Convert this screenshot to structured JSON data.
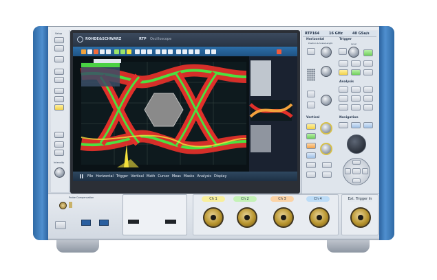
{
  "brand": {
    "logo_text": "ROHDE&SCHWARZ",
    "product": "RTP",
    "product_sub": "Oscilloscope"
  },
  "model": {
    "name": "RTP164",
    "bandwidth": "16 GHz",
    "sample_rate": "40 GSa/s"
  },
  "left_column": {
    "setup_label": "Setup",
    "intensity_label": "Intensity"
  },
  "sections": {
    "horizontal": "Horizontal",
    "horizontal_sub": "Position & Scale/Length",
    "trigger": "Trigger",
    "trigger_level": "Level",
    "analysis": "Analysis",
    "vertical": "Vertical",
    "navigation": "Navigation",
    "probe_comp": "Probe Compensation"
  },
  "channels": [
    {
      "id": "Ch1",
      "label": "Ch 1",
      "color": "#f3e35a"
    },
    {
      "id": "Ch2",
      "label": "Ch 2",
      "color": "#8ee87a"
    },
    {
      "id": "Ch3",
      "label": "Ch 3",
      "color": "#f3a24a"
    },
    {
      "id": "Ch4",
      "label": "Ch 4",
      "color": "#6fb6f0"
    }
  ],
  "ext_trigger_label": "Ext. Trigger In",
  "menu_items": [
    "File",
    "Horizontal",
    "Trigger",
    "Vertical",
    "Math",
    "Cursor",
    "Meas",
    "Masks",
    "Analysis",
    "Display"
  ],
  "colors": {
    "frame": "#3d78b3",
    "panel": "#dfe5ec",
    "screen_bg": "#0a1216",
    "eye_red": "#e0302a",
    "eye_green": "#4ce040",
    "eye_yellow": "#f4e13c",
    "mask": "#8a8a8a"
  }
}
